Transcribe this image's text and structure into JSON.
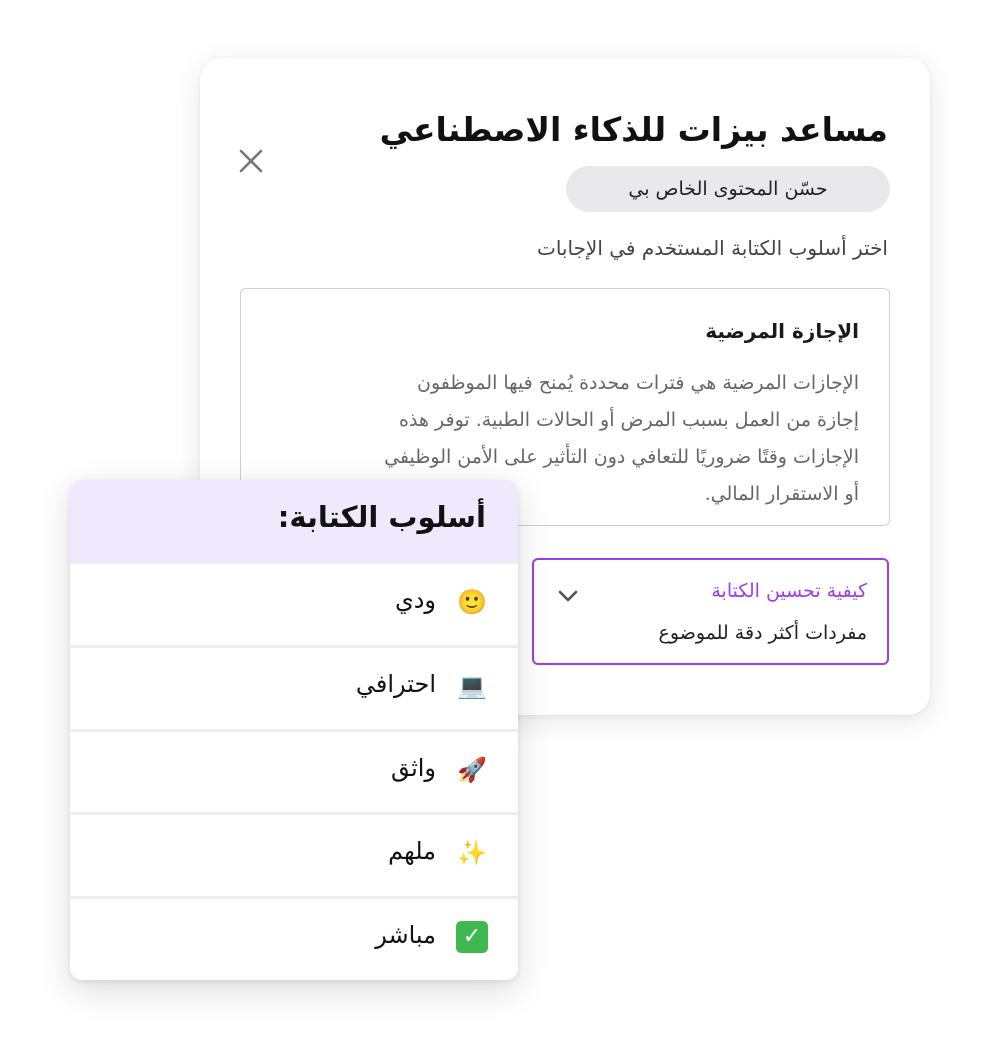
{
  "panel": {
    "title": "مساعد بيزات للذكاء الاصطناعي",
    "improve_chip_label": "حسّن المحتوى الخاص بي",
    "subtitle": "اختر أسلوب الكتابة المستخدم في الإجابات",
    "close_icon": "close-icon"
  },
  "preview": {
    "title": "الإجازة المرضية",
    "lines": [
      "الإجازات المرضية هي فترات محددة يُمنح فيها الموظفون",
      "إجازة من العمل بسبب المرض أو الحالات الطبية. توفر هذه",
      "الإجازات وقتًا ضروريًا للتعافي دون التأثير على الأمن الوظيفي",
      "أو الاستقرار المالي."
    ]
  },
  "improve_dropdown": {
    "label": "كيفية تحسين الكتابة",
    "value": "مفردات أكثر دقة للموضوع",
    "icon": "chevron-down-icon",
    "accent_color": "#9b3fe8"
  },
  "style_menu": {
    "title": "أسلوب الكتابة:",
    "items": [
      {
        "label": "ودي",
        "emoji": "🙂",
        "icon": "smiley-icon"
      },
      {
        "label": "احترافي",
        "emoji": "💻",
        "icon": "laptop-icon"
      },
      {
        "label": "واثق",
        "emoji": "🚀",
        "icon": "rocket-icon"
      },
      {
        "label": "ملهم",
        "emoji": "✨",
        "icon": "sparkles-icon"
      },
      {
        "label": "مباشر",
        "emoji": "✓",
        "icon": "check-icon"
      }
    ],
    "header_bg": "#efe9fd"
  }
}
